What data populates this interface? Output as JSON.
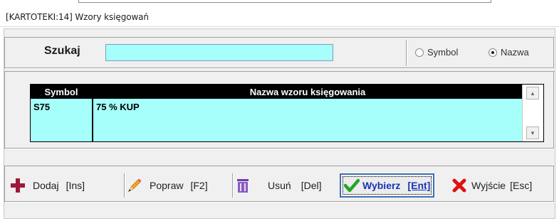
{
  "window": {
    "title": "[KARTOTEKI:14]  Wzory księgowań"
  },
  "search": {
    "label": "Szukaj",
    "value": "",
    "placeholder": ""
  },
  "search_mode": {
    "options": [
      {
        "label": "Symbol",
        "selected": false
      },
      {
        "label": "Nazwa",
        "selected": true
      }
    ]
  },
  "grid": {
    "columns": [
      "Symbol",
      "Nazwa wzoru księgowania"
    ],
    "rows": [
      {
        "symbol": "S75",
        "name": "75 % KUP"
      }
    ]
  },
  "toolbar": {
    "add": {
      "label": "Dodaj",
      "key": "[Ins]",
      "icon": "plus-icon"
    },
    "edit": {
      "label": "Popraw",
      "key": "[F2]",
      "icon": "pencil-icon"
    },
    "delete": {
      "label": "Usuń",
      "key": "[Del]",
      "icon": "trash-icon"
    },
    "select": {
      "label": "Wybierz",
      "key": "[Ent]",
      "icon": "checkmark-icon"
    },
    "exit": {
      "label": "Wyjście",
      "key": "[Esc]",
      "icon": "x-icon"
    }
  },
  "colors": {
    "accent_cyan": "#a6fffb",
    "header_black": "#000000",
    "selected_text": "#1733b8"
  }
}
